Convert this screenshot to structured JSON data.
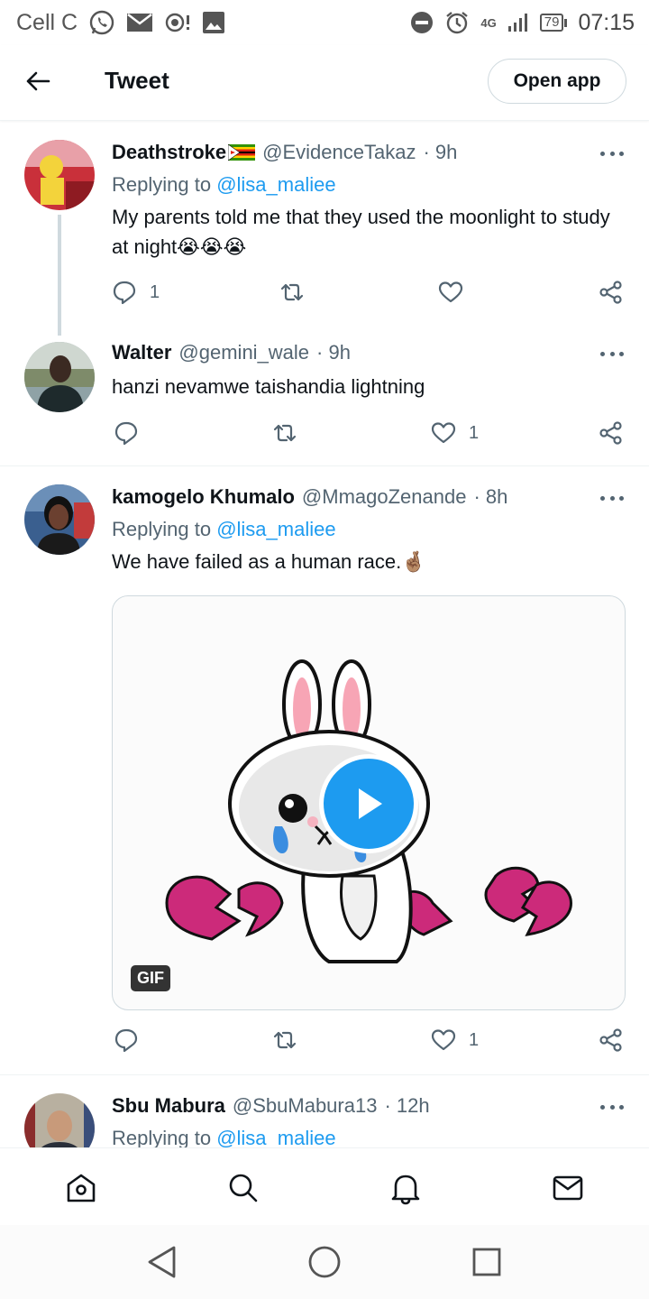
{
  "status_bar": {
    "carrier": "Cell C",
    "network": "4G",
    "battery": "79",
    "time": "07:15"
  },
  "header": {
    "title": "Tweet",
    "open_app_label": "Open app"
  },
  "tweets": [
    {
      "name": "Deathstroke",
      "handle": "@EvidenceTakaz",
      "time": "· 9h",
      "replying_prefix": "Replying to",
      "replying_to": "@lisa_maliee",
      "text": "My parents told me that they used the moonlight to study at night😭😭😭",
      "reply_count": "1",
      "retweet_count": "",
      "like_count": ""
    },
    {
      "name": "Walter",
      "handle": "@gemini_wale",
      "time": "· 9h",
      "text": "hanzi nevamwe taishandia lightning",
      "reply_count": "",
      "retweet_count": "",
      "like_count": "1"
    },
    {
      "name": "kamogelo Khumalo",
      "handle": "@MmagoZenande",
      "time": "· 8h",
      "replying_prefix": "Replying to",
      "replying_to": "@lisa_maliee",
      "text": "We have failed as a human race.🤞🏽",
      "media_badge": "GIF",
      "reply_count": "",
      "retweet_count": "",
      "like_count": "1"
    },
    {
      "name": "Sbu Mabura",
      "handle": "@SbuMabura13",
      "time": "· 12h",
      "replying_prefix": "Replying to",
      "replying_to": "@lisa_maliee"
    }
  ],
  "bottom_nav": [
    "home-icon",
    "search-icon",
    "notifications-icon",
    "messages-icon"
  ],
  "colors": {
    "accent": "#1d9bf0",
    "text_primary": "#0f1419",
    "text_secondary": "#536471",
    "border": "#cfd9de"
  }
}
